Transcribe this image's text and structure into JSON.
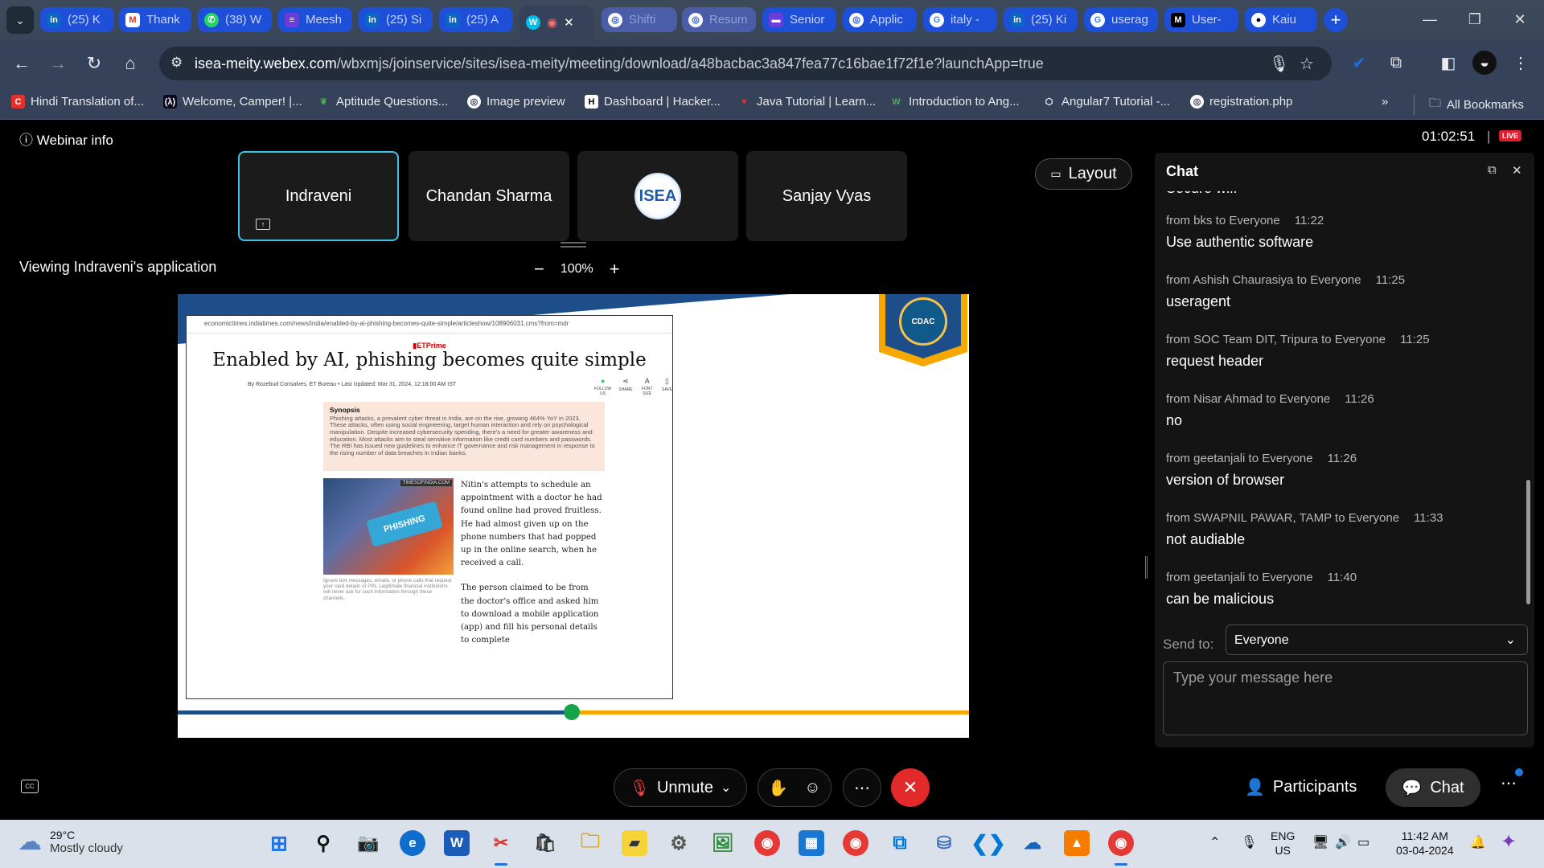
{
  "browser": {
    "tabs": [
      {
        "label": "(25) K",
        "icon": "linkedin-icon"
      },
      {
        "label": "Thank",
        "icon": "gmail-icon"
      },
      {
        "label": "(38) W",
        "icon": "whatsapp-icon"
      },
      {
        "label": "Meesh",
        "icon": "meesho-icon"
      },
      {
        "label": "(25) Si",
        "icon": "linkedin-icon"
      },
      {
        "label": "(25) A",
        "icon": "linkedin-icon"
      },
      {
        "label": "",
        "icon": "webex-icon"
      },
      {
        "label": "Shifti",
        "icon": "globe-icon"
      },
      {
        "label": "Resum",
        "icon": "globe-icon"
      },
      {
        "label": "Senior",
        "icon": "job-icon"
      },
      {
        "label": "Applic",
        "icon": "globe-icon"
      },
      {
        "label": "italy -",
        "icon": "google-icon"
      },
      {
        "label": "(25) Ki",
        "icon": "linkedin-icon"
      },
      {
        "label": "userag",
        "icon": "google-icon"
      },
      {
        "label": "User-",
        "icon": "mdn-icon"
      },
      {
        "label": "Kaiu",
        "icon": "github-icon"
      }
    ],
    "url_domain": "isea-meity.webex.com",
    "url_path": "/wbxmjs/joinservice/sites/isea-meity/meeting/download/a48bacbac3a847fea77c16bae1f72f1e?launchApp=true",
    "bookmarks": [
      "Hindi Translation of...",
      "Welcome, Camper! |...",
      "Aptitude Questions...",
      "Image preview",
      "Dashboard | Hacker...",
      "Java Tutorial | Learn...",
      "Introduction to Ang...",
      "Angular7 Tutorial -...",
      "registration.php"
    ],
    "all_bookmarks": "All Bookmarks"
  },
  "meeting": {
    "webinar_info": "Webinar info",
    "timer": "01:02:51",
    "live_badge": "LIVE",
    "participants": [
      "Indraveni",
      "Chandan Sharma",
      "Sanjay Vyas"
    ],
    "isea_logo_text": "ISEA",
    "layout_label": "Layout",
    "viewing_label": "Viewing Indraveni's application",
    "zoom_level": "100%"
  },
  "shared_screen": {
    "article_url": "economictimes.indiatimes.com/news/india/enabled-by-ai-phishing-becomes-quite-simple/articleshow/108906031.cms?from=mdr",
    "brand": "ETPrime",
    "title": "Enabled by AI, phishing becomes quite simple",
    "byline": "By Rozebud Consalves, ET Bureau • Last Updated: Mar 31, 2024, 12:18:00 AM IST",
    "tools": [
      "FOLLOW US",
      "SHARE",
      "FONT SIZE",
      "SAVE"
    ],
    "synopsis_heading": "Synopsis",
    "synopsis_text": "Phishing attacks, a prevalent cyber threat in India, are on the rise, growing 464% YoY in 2023. These attacks, often using social engineering, target human interaction and rely on psychological manipulation. Despite increased cybersecurity spending, there's a need for greater awareness and education. Most attacks aim to steal sensitive information like credit card numbers and passwords. The RBI has issued new guidelines to enhance IT governance and risk management in response to the rising number of data breaches in Indian banks.",
    "image_source": "TIMESOFINDIA.COM",
    "image_key_text": "PHISHING",
    "image_caption": "Ignore text messages, emails, or phone calls that request your card details or PIN. Legitimate financial institutions will never ask for such information through these channels.",
    "body_p1": "Nitin's attempts to schedule an appointment with a doctor he had found online had proved fruitless. He had almost given up on the phone numbers that had popped up in the online search, when he received a call.",
    "body_p2": "The person claimed to be from the doctor's office and asked him to download a mobile application (app) and fill his personal details to complete",
    "emblem_text": "CDAC",
    "slide_progress": 0.5
  },
  "chat": {
    "title": "Chat",
    "partial_top": "Secure wifi",
    "messages": [
      {
        "from": "from bks to Everyone",
        "time": "11:22",
        "text": "Use authentic software"
      },
      {
        "from": "from Ashish Chaurasiya to Everyone",
        "time": "11:25",
        "text": "useragent"
      },
      {
        "from": "from SOC Team DIT, Tripura to Everyone",
        "time": "11:25",
        "text": "request header"
      },
      {
        "from": "from Nisar Ahmad to Everyone",
        "time": "11:26",
        "text": "no"
      },
      {
        "from": "from geetanjali to Everyone",
        "time": "11:26",
        "text": "version of browser"
      },
      {
        "from": "from SWAPNIL PAWAR, TAMP to Everyone",
        "time": "11:33",
        "text": "not audiable"
      },
      {
        "from": "from geetanjali to Everyone",
        "time": "11:40",
        "text": "can be malicious"
      }
    ],
    "send_to_label": "Send to:",
    "send_to_value": "Everyone",
    "input_placeholder": "Type your message here"
  },
  "controls": {
    "unmute": "Unmute",
    "participants": "Participants",
    "chat": "Chat"
  },
  "taskbar": {
    "temperature": "29°C",
    "weather": "Mostly cloudy",
    "lang1": "ENG",
    "lang2": "US",
    "time": "11:42 AM",
    "date": "03-04-2024"
  }
}
